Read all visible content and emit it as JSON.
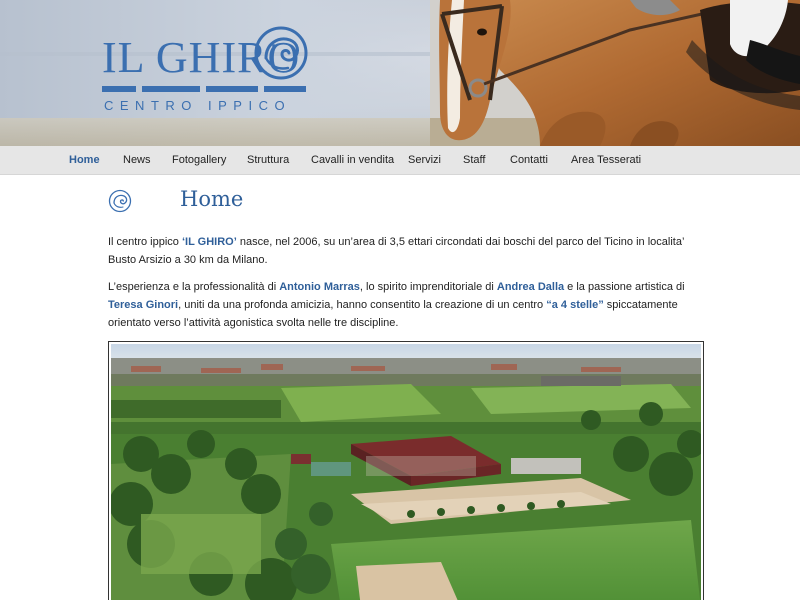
{
  "logo": {
    "name": "IL GHIRO",
    "tagline": "CENTRO IPPICO"
  },
  "nav": {
    "items": [
      {
        "label": "Home",
        "active": true
      },
      {
        "label": "News"
      },
      {
        "label": "Fotogallery"
      },
      {
        "label": "Struttura"
      },
      {
        "label": "Cavalli in vendita"
      },
      {
        "label": "Servizi"
      },
      {
        "label": "Staff"
      },
      {
        "label": "Contatti"
      },
      {
        "label": "Area Tesserati"
      }
    ]
  },
  "page": {
    "title": "Home",
    "p1": {
      "t1": "Il centro ippico ",
      "b1": "‘IL GHIRO’",
      "t2": " nasce, nel 2006, su un’area di 3,5 ettari circondati dai boschi del parco del Ticino in localita’ Busto Arsizio a 30 km da Milano."
    },
    "p2": {
      "t1": "L’esperienza e la professionalità di ",
      "b1": "Antonio Marras",
      "t2": ", lo spirito imprenditoriale di ",
      "b2": "Andrea Dalla",
      "t3": " e la passione artistica di ",
      "b3": "Teresa Ginori",
      "t4": ", uniti da una profonda amicizia, hanno consentito la creazione di un centro ",
      "b4": "“a 4 stelle”",
      "t5": " spiccatamente orientato verso l’attività agonistica svolta nelle tre discipline."
    }
  },
  "colors": {
    "brand_blue": "#3b6fb0",
    "link_blue": "#2f5f99",
    "nav_bg": "#e6e6e6"
  },
  "icons": {
    "logo_mark": "squirrel-icon",
    "title_mark": "squirrel-icon"
  }
}
